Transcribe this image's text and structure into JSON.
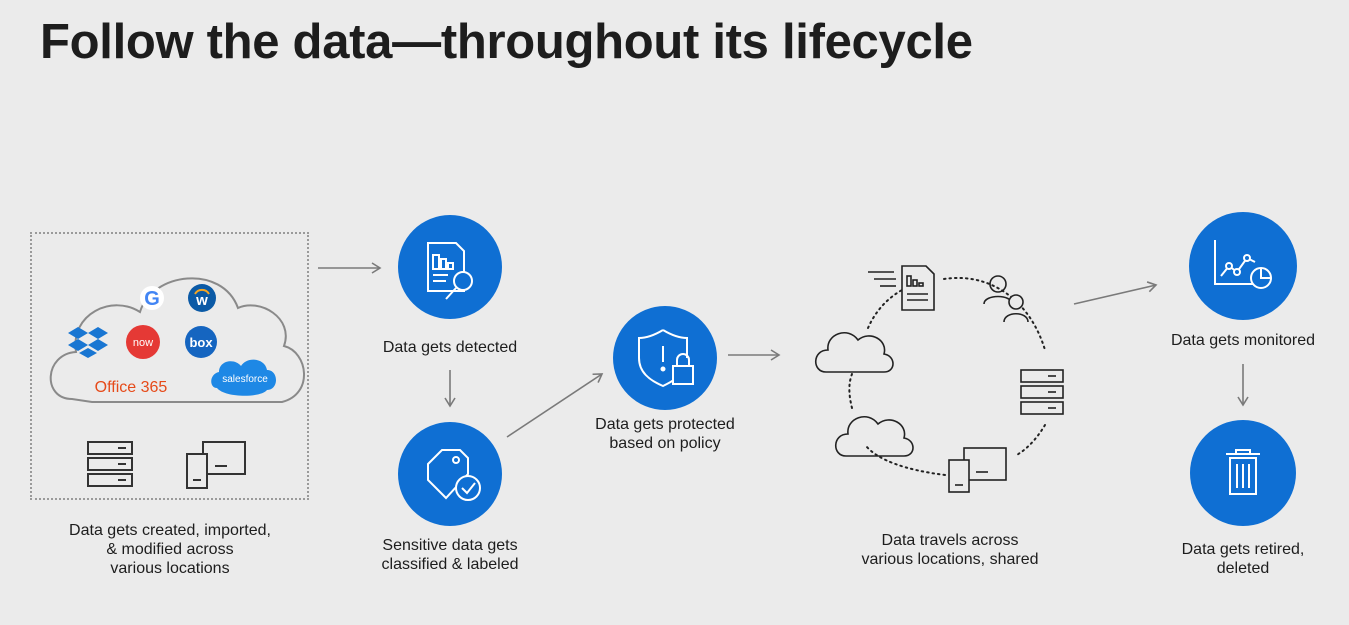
{
  "title": "Follow the data—throughout its lifecycle",
  "sources": {
    "caption_lines": [
      "Data gets created, imported,",
      "& modified across",
      "various locations"
    ],
    "logos": {
      "office": "Office 365",
      "now": "now",
      "box": "box",
      "salesforce": "salesforce",
      "google": "G",
      "workday": "w"
    }
  },
  "steps": {
    "detected": "Data gets detected",
    "classified_lines": [
      "Sensitive data gets",
      "classified & labeled"
    ],
    "protected_lines": [
      "Data gets protected",
      "based on policy"
    ],
    "travels_lines": [
      "Data travels across",
      "various locations, shared"
    ],
    "monitored": "Data gets monitored",
    "retired_lines": [
      "Data gets retired,",
      "deleted"
    ]
  },
  "icons": {
    "detect": "document-search-icon",
    "classify": "tag-check-icon",
    "protect": "shield-lock-icon",
    "monitor": "chart-monitor-icon",
    "retire": "trash-icon"
  },
  "colors": {
    "accent": "#0f6fd3",
    "background": "#ebebeb",
    "office": "#e64a19",
    "now": "#e53935",
    "box": "#1565c0",
    "salesforce": "#1e88e5",
    "dropbox": "#1976d2"
  }
}
